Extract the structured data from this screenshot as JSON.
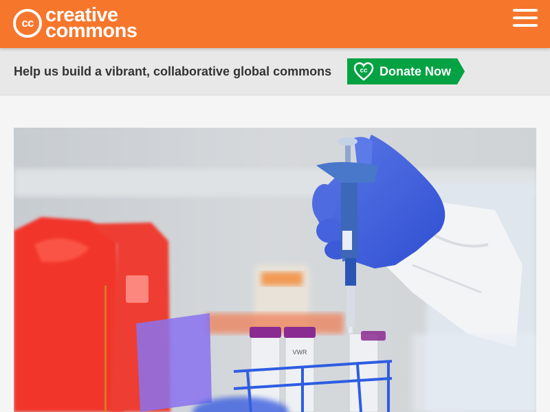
{
  "header": {
    "logo": {
      "cc_mark": "cc",
      "line1": "creative",
      "line2": "commons"
    },
    "menu_icon": "hamburger-menu-icon"
  },
  "banner": {
    "message": "Help us build a vibrant, collaborative global commons",
    "donate": {
      "icon": "cc-heart-icon",
      "label": "Donate Now",
      "color": "#05a243"
    }
  },
  "colors": {
    "brand": "#f6762c",
    "banner_bg": "#e8e8e8",
    "page_bg": "#f5f5f5"
  },
  "hero_image": {
    "label_text": "VWR"
  }
}
